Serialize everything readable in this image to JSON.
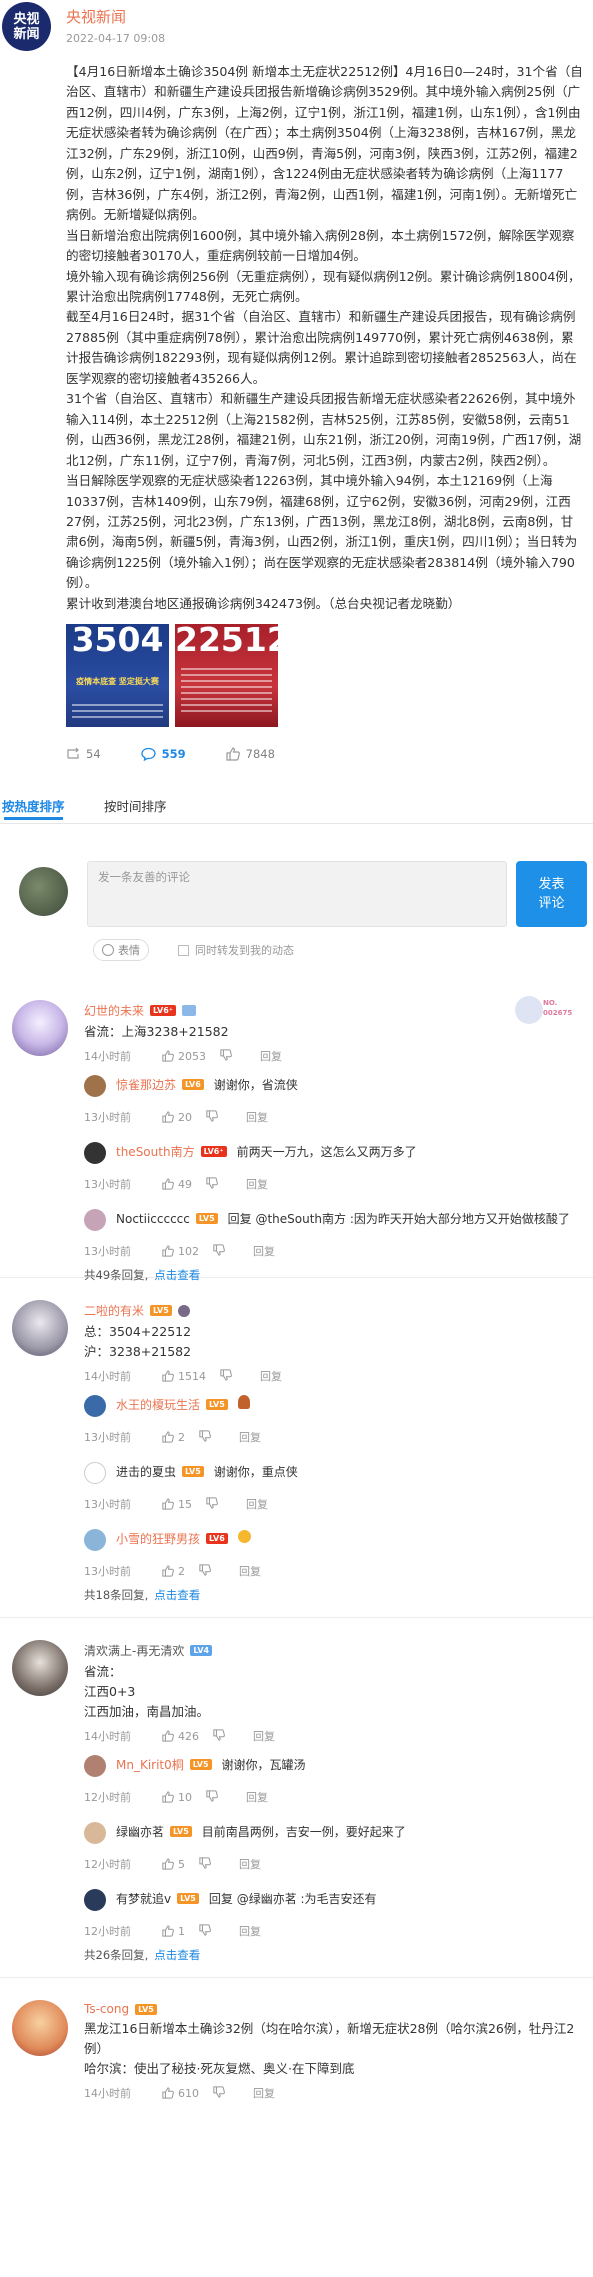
{
  "post": {
    "logo_line1": "央视",
    "logo_line2": "新闻",
    "author": "央视新闻",
    "time": "2022-04-17 09:08",
    "paragraphs": [
      "【4月16日新增本土确诊3504例 新增本土无症状22512例】4月16日0—24时，31个省（自治区、直辖市）和新疆生产建设兵团报告新增确诊病例3529例。其中境外输入病例25例（广西12例，四川4例，广东3例，上海2例，辽宁1例，浙江1例，福建1例，山东1例），含1例由无症状感染者转为确诊病例（在广西）；本土病例3504例（上海3238例，吉林167例，黑龙江32例，广东29例，浙江10例，山西9例，青海5例，河南3例，陕西3例，江苏2例，福建2例，山东2例，辽宁1例，湖南1例），含1224例由无症状感染者转为确诊病例（上海1177例，吉林36例，广东4例，浙江2例，青海2例，山西1例，福建1例，河南1例）。无新增死亡病例。无新增疑似病例。",
      "当日新增治愈出院病例1600例，其中境外输入病例28例，本土病例1572例，解除医学观察的密切接触者30170人，重症病例较前一日增加4例。",
      "境外输入现有确诊病例256例（无重症病例），现有疑似病例12例。累计确诊病例18004例，累计治愈出院病例17748例，无死亡病例。",
      "截至4月16日24时，据31个省（自治区、直辖市）和新疆生产建设兵团报告，现有确诊病例27885例（其中重症病例78例），累计治愈出院病例149770例，累计死亡病例4638例，累计报告确诊病例182293例，现有疑似病例12例。累计追踪到密切接触者2852563人，尚在医学观察的密切接触者435266人。",
      "31个省（自治区、直辖市）和新疆生产建设兵团报告新增无症状感染者22626例，其中境外输入114例，本土22512例（上海21582例，吉林525例，江苏85例，安徽58例，云南51例，山西36例，黑龙江28例，福建21例，山东21例，浙江20例，河南19例，广西17例，湖北12例，广东11例，辽宁7例，青海7例，河北5例，江西3例，内蒙古2例，陕西2例）。",
      "当日解除医学观察的无症状感染者12263例，其中境外输入94例，本土12169例（上海10337例，吉林1409例，山东79例，福建68例，辽宁62例，安徽36例，河南29例，江西27例，江苏25例，河北23例，广东13例，广西13例，黑龙江8例，湖北8例，云南8例，甘肃6例，海南5例，新疆5例，青海3例，山西2例，浙江1例，重庆1例，四川1例）；当日转为确诊病例1225例（境外输入1例）；尚在医学观察的无症状感染者283814例（境外输入790例）。",
      "累计收到港澳台地区通报确诊病例342473例。（总台央视记者龙晓勤）"
    ],
    "image1_number": "3504",
    "image1_caption": "疫情本底查 坚定挺大赛",
    "image2_number": "22512",
    "reposts": "54",
    "comments": "559",
    "likes": "7848"
  },
  "tabs": {
    "hot": "按热度排序",
    "time": "按时间排序"
  },
  "composer": {
    "placeholder": "发一条友善的评论",
    "submit_line1": "发表",
    "submit_line2": "评论",
    "emoji": "表情",
    "sync": "同时转发到我的动态"
  },
  "comments": [
    {
      "name": "幻世的未来",
      "medal_text1": "NO.",
      "medal_text2": "002675",
      "lines": [
        "省流：上海3238+21582"
      ],
      "time": "14小时前",
      "likes": "2053",
      "reply_label": "回复",
      "replies": [
        {
          "name": "惊雀那边苏",
          "text": "谢谢你，省流侠",
          "time": "13小时前",
          "likes": "20",
          "reply_label": "回复"
        },
        {
          "name": "theSouth南方",
          "text": "前两天一万九，这怎么又两万多了",
          "time": "13小时前",
          "likes": "49",
          "reply_label": "回复"
        },
        {
          "name": "Noctiicccccc",
          "text": "回复 @theSouth南方 :因为昨天开始大部分地方又开始做核酸了",
          "time": "13小时前",
          "likes": "102",
          "reply_label": "回复"
        }
      ],
      "total_text": "共49条回复,",
      "total_link": "点击查看"
    },
    {
      "name": "二啦的有米",
      "lines": [
        "总：3504+22512",
        "沪：3238+21582"
      ],
      "time": "14小时前",
      "likes": "1514",
      "reply_label": "回复",
      "replies": [
        {
          "name": "水王的榎玩生活",
          "text": "",
          "time": "13小时前",
          "likes": "2",
          "reply_label": "回复"
        },
        {
          "name": "进击的夏虫",
          "text": "谢谢你，重点侠",
          "time": "13小时前",
          "likes": "15",
          "reply_label": "回复"
        },
        {
          "name": "小雪的狂野男孩",
          "text": "",
          "time": "13小时前",
          "likes": "2",
          "reply_label": "回复"
        }
      ],
      "total_text": "共18条回复,",
      "total_link": "点击查看"
    },
    {
      "name": "清欢满上-再无清欢",
      "lines": [
        "省流：",
        "江西0+3",
        "江西加油，南昌加油。"
      ],
      "time": "14小时前",
      "likes": "426",
      "reply_label": "回复",
      "replies": [
        {
          "name": "Mn_Kirit0桐",
          "text": "谢谢你，瓦罐汤",
          "time": "12小时前",
          "likes": "10",
          "reply_label": "回复"
        },
        {
          "name": "绿幽亦茗",
          "text": "目前南昌两例，吉安一例，要好起来了",
          "time": "12小时前",
          "likes": "5",
          "reply_label": "回复"
        },
        {
          "name": "有梦就追v",
          "text": "回复 @绿幽亦茗 :为毛吉安还有",
          "time": "12小时前",
          "likes": "1",
          "reply_label": "回复"
        }
      ],
      "total_text": "共26条回复,",
      "total_link": "点击查看"
    },
    {
      "name": "Ts-cong",
      "lines": [
        "黑龙江16日新增本土确诊32例（均在哈尔滨），新增无症状28例（哈尔滨26例，牡丹江2例）",
        "哈尔滨：使出了秘技·死灰复燃、奥义·在下障到底"
      ],
      "time": "14小时前",
      "likes": "610",
      "reply_label": "回复",
      "replies": [],
      "total_text": "",
      "total_link": ""
    }
  ]
}
